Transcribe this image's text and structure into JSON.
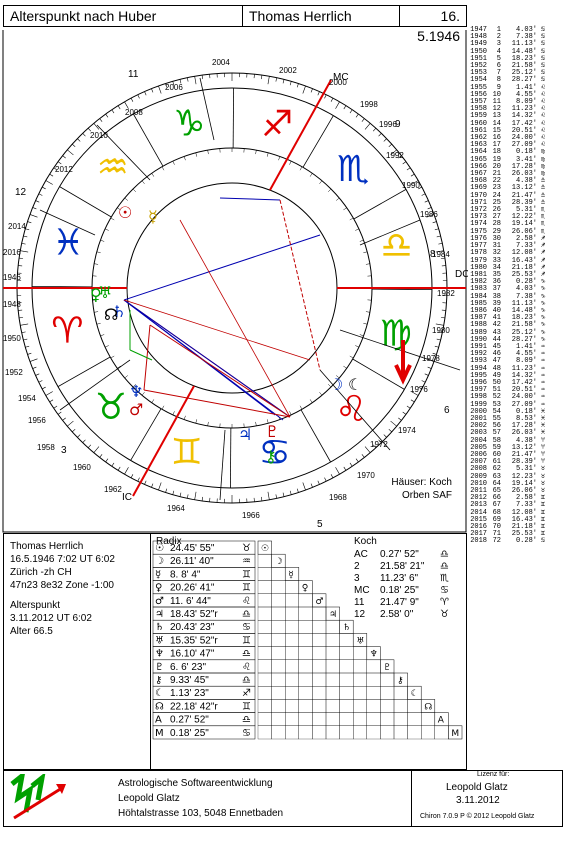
{
  "header": {
    "title": "Alterspunkt nach Huber",
    "person": "Thomas Herrlich",
    "date": "16. 5.1946"
  },
  "wheel": {
    "axis_labels": [
      "MC",
      "DC",
      "IC",
      "11",
      "12",
      "9",
      "8",
      "3",
      "5",
      "6"
    ],
    "year_marks": [
      "2004",
      "2002",
      "2000",
      "1998",
      "1996",
      "1992",
      "1990",
      "1986",
      "1984",
      "1982",
      "1980",
      "1978",
      "1976",
      "1974",
      "1972",
      "1970",
      "1968",
      "1966",
      "1964",
      "1962",
      "1960",
      "1958",
      "1956",
      "1954",
      "1952",
      "1950",
      "1948",
      "1946",
      "2016",
      "2014",
      "2012",
      "2010",
      "2008",
      "2006"
    ],
    "houses_label": "Häuser: Koch",
    "orben_label": "Orben SAF"
  },
  "year_table": [
    [
      "1947",
      "1",
      "4.03'",
      "♋"
    ],
    [
      "1948",
      "2",
      "7.38'",
      "♋"
    ],
    [
      "1949",
      "3",
      "11.13'",
      "♋"
    ],
    [
      "1950",
      "4",
      "14.48'",
      "♋"
    ],
    [
      "1951",
      "5",
      "18.23'",
      "♋"
    ],
    [
      "1952",
      "6",
      "21.58'",
      "♋"
    ],
    [
      "1953",
      "7",
      "25.12'",
      "♋"
    ],
    [
      "1954",
      "8",
      "28.27'",
      "♋"
    ],
    [
      "1955",
      "9",
      "1.41'",
      "♌"
    ],
    [
      "1956",
      "10",
      "4.55'",
      "♌"
    ],
    [
      "1957",
      "11",
      "8.09'",
      "♌"
    ],
    [
      "1958",
      "12",
      "11.23'",
      "♌"
    ],
    [
      "1959",
      "13",
      "14.32'",
      "♌"
    ],
    [
      "1960",
      "14",
      "17.42'",
      "♌"
    ],
    [
      "1961",
      "15",
      "20.51'",
      "♌"
    ],
    [
      "1962",
      "16",
      "24.00'",
      "♌"
    ],
    [
      "1963",
      "17",
      "27.09'",
      "♌"
    ],
    [
      "1964",
      "18",
      "0.18'",
      "♍"
    ],
    [
      "1965",
      "19",
      "3.41'",
      "♍"
    ],
    [
      "1966",
      "20",
      "17.28'",
      "♍"
    ],
    [
      "1967",
      "21",
      "26.03'",
      "♍"
    ],
    [
      "1968",
      "22",
      "4.38'",
      "♎"
    ],
    [
      "1969",
      "23",
      "13.12'",
      "♎"
    ],
    [
      "1970",
      "24",
      "21.47'",
      "♎"
    ],
    [
      "1971",
      "25",
      "28.39'",
      "♎"
    ],
    [
      "1972",
      "26",
      "5.31'",
      "♏"
    ],
    [
      "1973",
      "27",
      "12.22'",
      "♏"
    ],
    [
      "1974",
      "28",
      "19.14'",
      "♏"
    ],
    [
      "1975",
      "29",
      "26.06'",
      "♏"
    ],
    [
      "1976",
      "30",
      "2.58'",
      "♐"
    ],
    [
      "1977",
      "31",
      "7.33'",
      "♐"
    ],
    [
      "1978",
      "32",
      "12.08'",
      "♐"
    ],
    [
      "1979",
      "33",
      "16.43'",
      "♐"
    ],
    [
      "1980",
      "34",
      "21.18'",
      "♐"
    ],
    [
      "1981",
      "35",
      "25.53'",
      "♐"
    ],
    [
      "1982",
      "36",
      "0.28'",
      "♑"
    ],
    [
      "1983",
      "37",
      "4.03'",
      "♑"
    ],
    [
      "1984",
      "38",
      "7.38'",
      "♑"
    ],
    [
      "1985",
      "39",
      "11.13'",
      "♑"
    ],
    [
      "1986",
      "40",
      "14.48'",
      "♑"
    ],
    [
      "1987",
      "41",
      "18.23'",
      "♑"
    ],
    [
      "1988",
      "42",
      "21.58'",
      "♑"
    ],
    [
      "1989",
      "43",
      "25.12'",
      "♑"
    ],
    [
      "1990",
      "44",
      "28.27'",
      "♑"
    ],
    [
      "1991",
      "45",
      "1.41'",
      "♒"
    ],
    [
      "1992",
      "46",
      "4.55'",
      "♒"
    ],
    [
      "1993",
      "47",
      "8.09'",
      "♒"
    ],
    [
      "1994",
      "48",
      "11.23'",
      "♒"
    ],
    [
      "1995",
      "49",
      "14.32'",
      "♒"
    ],
    [
      "1996",
      "50",
      "17.42'",
      "♒"
    ],
    [
      "1997",
      "51",
      "20.51'",
      "♒"
    ],
    [
      "1998",
      "52",
      "24.00'",
      "♒"
    ],
    [
      "1999",
      "53",
      "27.09'",
      "♒"
    ],
    [
      "2000",
      "54",
      "0.18'",
      "♓"
    ],
    [
      "2001",
      "55",
      "8.53'",
      "♓"
    ],
    [
      "2002",
      "56",
      "17.28'",
      "♓"
    ],
    [
      "2003",
      "57",
      "26.03'",
      "♓"
    ],
    [
      "2004",
      "58",
      "4.38'",
      "♈"
    ],
    [
      "2005",
      "59",
      "13.12'",
      "♈"
    ],
    [
      "2006",
      "60",
      "21.47'",
      "♈"
    ],
    [
      "2007",
      "61",
      "28.39'",
      "♈"
    ],
    [
      "2008",
      "62",
      "5.31'",
      "♉"
    ],
    [
      "2009",
      "63",
      "12.23'",
      "♉"
    ],
    [
      "2010",
      "64",
      "19.14'",
      "♉"
    ],
    [
      "2011",
      "65",
      "26.06'",
      "♉"
    ],
    [
      "2012",
      "66",
      "2.58'",
      "♊"
    ],
    [
      "2013",
      "67",
      "7.33'",
      "♊"
    ],
    [
      "2014",
      "68",
      "12.08'",
      "♊"
    ],
    [
      "2015",
      "69",
      "16.43'",
      "♊"
    ],
    [
      "2016",
      "70",
      "21.18'",
      "♊"
    ],
    [
      "2017",
      "71",
      "25.53'",
      "♊"
    ],
    [
      "2018",
      "72",
      "0.28'",
      "♋"
    ]
  ],
  "info": {
    "name": "Thomas Herrlich",
    "line1": "16.5.1946 7:02 UT 6:02",
    "line2": "Zürich -zh CH",
    "line3": "47n23 8e32 Zone -1:00",
    "ap_title": "Alterspunkt",
    "ap_date": " 3.11.2012 UT  6:02",
    "ap_age": "Alter 66.5"
  },
  "radix": {
    "title": "Radix",
    "rows": [
      [
        "☉",
        "24.45' 55\"",
        "♉"
      ],
      [
        "☽",
        "26.11' 40\"",
        "♒"
      ],
      [
        "☿",
        "8.  8'  4\"",
        "♊"
      ],
      [
        "♀",
        "20.26' 41\"",
        "♊"
      ],
      [
        "♂",
        "11.  6' 44\"",
        "♌"
      ],
      [
        "♃",
        "18.43' 52\"r",
        "♎"
      ],
      [
        "♄",
        "20.43' 23\"",
        "♋"
      ],
      [
        "♅",
        "15.35' 52\"r",
        "♊"
      ],
      [
        "♆",
        "16.10' 47\"",
        "♎"
      ],
      [
        "♇",
        "6.  6' 23\"",
        "♌"
      ],
      [
        "⚷",
        "9.33' 45\"",
        "♎"
      ],
      [
        "☾",
        "1.13' 23\"",
        "♐"
      ],
      [
        "☊",
        "22.18' 42\"r",
        "♊"
      ],
      [
        "A",
        "0.27' 52\"",
        "♎"
      ],
      [
        "M",
        "0.18' 25\"",
        "♋"
      ]
    ]
  },
  "koch": {
    "title": "Koch",
    "rows": [
      [
        "AC",
        "0.27' 52\"",
        "♎"
      ],
      [
        "2",
        "21.58' 21\"",
        "♎"
      ],
      [
        "3",
        "11.23'  6\"",
        "♏"
      ],
      [
        "MC",
        "0.18' 25\"",
        "♋"
      ],
      [
        "11",
        "21.47'  9\"",
        "♈"
      ],
      [
        "12",
        "2.58'  0\"",
        "♉"
      ]
    ]
  },
  "footer": {
    "company": "Astrologische Softwareentwicklung",
    "person": "Leopold Glatz",
    "address": "Höhtalstrasse 103, 5048 Ennetbaden",
    "licence_label": "Lizenz für:",
    "licensee": "Leopold Glatz",
    "licence_date": "3.11.2012",
    "copyright": "Chiron 7.0.9 P © 2012 Leopold Glatz"
  },
  "colors": {
    "fire": "#e00000",
    "earth": "#00a000",
    "air": "#f0c000",
    "water": "#0030c0"
  }
}
